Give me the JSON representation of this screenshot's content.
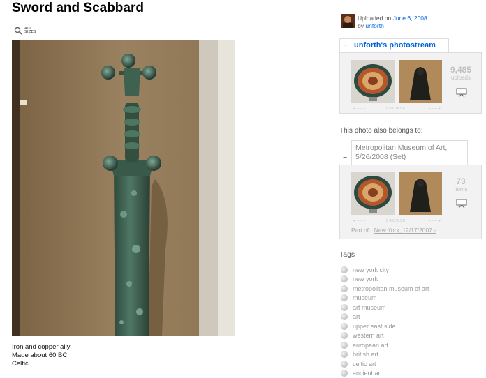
{
  "photo": {
    "title": "Sword and Scabbard",
    "all_sizes_line1": "ALL",
    "all_sizes_line2": "SIZES",
    "caption": [
      "Iron and copper ally",
      "Made about 60 BC",
      "Celtic"
    ]
  },
  "uploader": {
    "uploaded_prefix": "Uploaded on",
    "date": "June 6, 2008",
    "by_prefix": "by",
    "username": "unforth"
  },
  "photostream": {
    "title": "unforth's photostream",
    "count": "9,485",
    "count_unit": "uploads",
    "nav_label": "BROWSE"
  },
  "belongs": {
    "label": "This photo also belongs to:",
    "set_title_line1": "Metropolitan Museum of Art,",
    "set_title_line2": "5/26/2008 (Set)",
    "count": "73",
    "count_unit": "items",
    "nav_label": "BROWSE",
    "part_of_prefix": "Part of:",
    "part_of_link": "New York, 12/17/2007 -"
  },
  "tags": {
    "label": "Tags",
    "items": [
      "new york city",
      "new york",
      "metropolitan museum of art",
      "museum",
      "art museum",
      "art",
      "upper east side",
      "western art",
      "european art",
      "british art",
      "celtic art",
      "ancient art"
    ]
  },
  "colors": {
    "link": "#0063dc",
    "title": "#000000",
    "panel_bg": "#f2f2f2",
    "muted": "#999999"
  }
}
